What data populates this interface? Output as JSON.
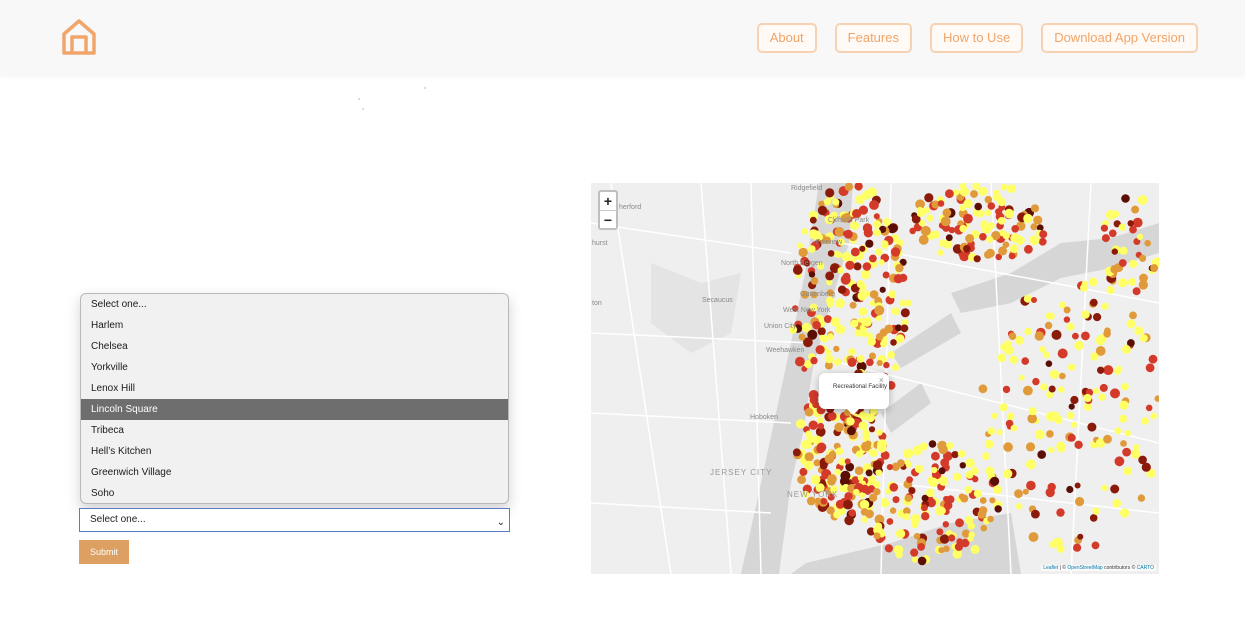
{
  "header": {
    "logo_icon": "house-icon",
    "brand_color": "#f0a56a",
    "nav": [
      "About",
      "Features",
      "How to Use",
      "Download App Version"
    ]
  },
  "form": {
    "options": [
      "Select one...",
      "Harlem",
      "Chelsea",
      "Yorkville",
      "Lenox Hill",
      "Lincoln Square",
      "Tribeca",
      "Hell’s Kitchen",
      "Greenwich Village",
      "Soho"
    ],
    "highlighted_option": "Lincoln Square",
    "select_value": "Select one...",
    "submit_label": "Submit",
    "submit_color": "#dca063"
  },
  "map": {
    "zoom_in": "+",
    "zoom_out": "−",
    "popup_text": "Recreational Facility",
    "popup_close": "×",
    "labels": [
      "Ridgefield",
      "herford",
      "Cliffside Park",
      "hurst",
      "Fairview",
      "North Bergen",
      "Secaucus",
      "Guttenberg",
      "West New York",
      "ton",
      "Union City",
      "Weehawken",
      "Hoboken",
      "JERSEY CITY",
      "NEW YORK"
    ],
    "attribution": {
      "leaflet": "Leaflet",
      "sep": " | © ",
      "osm": "OpenStreetMap",
      "mid": " contributors © ",
      "carto": "CARTO"
    },
    "point_colors": [
      "#ffff66",
      "#e09a3a",
      "#d43a2a",
      "#8a1a0a",
      "#5a0e06"
    ]
  }
}
